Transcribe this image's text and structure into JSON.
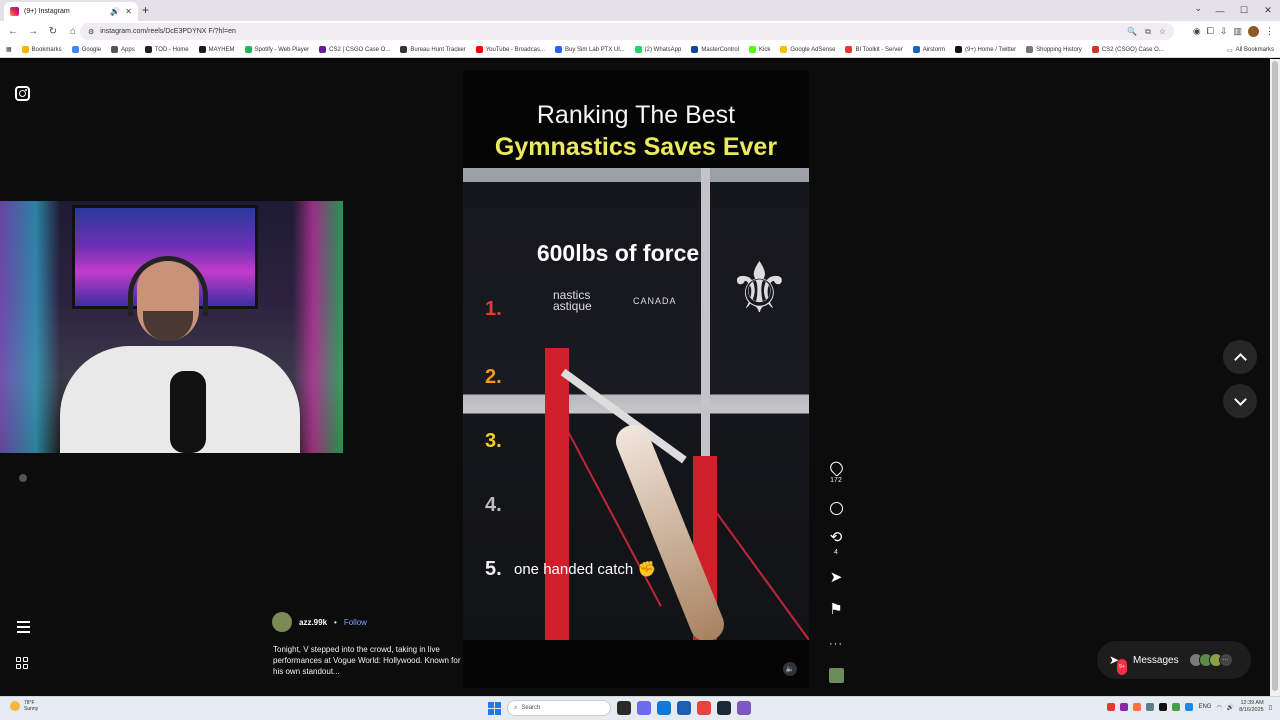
{
  "browser": {
    "tab_title": "(9+) Instagram",
    "new_tab_symbol": "+",
    "url": "instagram.com/reels/DcE3PDYNX F/?hl=en",
    "bookmarks": [
      {
        "label": "Bookmarks",
        "color": "#f4b400"
      },
      {
        "label": "Google",
        "color": "#4285f4"
      },
      {
        "label": "Apps",
        "color": "#555555"
      },
      {
        "label": "TOD - Home",
        "color": "#222222"
      },
      {
        "label": "MAYHEM",
        "color": "#1a1a1a"
      },
      {
        "label": "Spotify - Web Player",
        "color": "#1db954"
      },
      {
        "label": "CS2 | CSGO Case O...",
        "color": "#6a1b9a"
      },
      {
        "label": "Bureau Hunt Tracker",
        "color": "#333333"
      },
      {
        "label": "YouTube - Broadcas...",
        "color": "#ff0000"
      },
      {
        "label": "Buy Sim Lab PTX Ul...",
        "color": "#2962ff"
      },
      {
        "label": "(2) WhatsApp",
        "color": "#25d366"
      },
      {
        "label": "MasterControl",
        "color": "#0d47a1"
      },
      {
        "label": "Kick",
        "color": "#53fc18"
      },
      {
        "label": "Google AdSense",
        "color": "#fbbc04"
      },
      {
        "label": "BI Toolkit - Server",
        "color": "#e53935"
      },
      {
        "label": "Airstorm",
        "color": "#1565c0"
      },
      {
        "label": "(9+) Home / Twitter",
        "color": "#111111"
      },
      {
        "label": "Shopping History",
        "color": "#777777"
      },
      {
        "label": "CS2 (CSGO) Case O...",
        "color": "#d32f2f"
      }
    ],
    "all_bookmarks": "All Bookmarks"
  },
  "reel": {
    "title_line1": "Ranking The Best",
    "title_line2": "Gymnastics Saves Ever",
    "overlay_force": "600lbs of force",
    "brand_text": "nastics\nastique",
    "brand_country": "CANADA",
    "ranks": [
      {
        "label": "1.",
        "color": "#e53935"
      },
      {
        "label": "2.",
        "color": "#f39c12"
      },
      {
        "label": "3.",
        "color": "#f7d21e"
      },
      {
        "label": "4.",
        "color": "#bdbdbd"
      },
      {
        "label": "5.",
        "color": "#eeeeee"
      }
    ],
    "item5_text": "one handed catch",
    "item5_emoji": "✊"
  },
  "actions": {
    "like_count": "172",
    "repost_count": "4"
  },
  "post": {
    "author": "azz.99k",
    "separator": "•",
    "follow_label": "Follow",
    "caption": "Tonight, V stepped into the crowd, taking in live performances at Vogue World: Hollywood. Known for his own standout..."
  },
  "messages": {
    "label": "Messages",
    "badge": "9+"
  },
  "taskbar": {
    "weather_temp": "78°F",
    "weather_desc": "Sunny",
    "search_placeholder": "Search",
    "lang": "ENG",
    "time": "12:39 AM",
    "date": "8/16/2025"
  }
}
